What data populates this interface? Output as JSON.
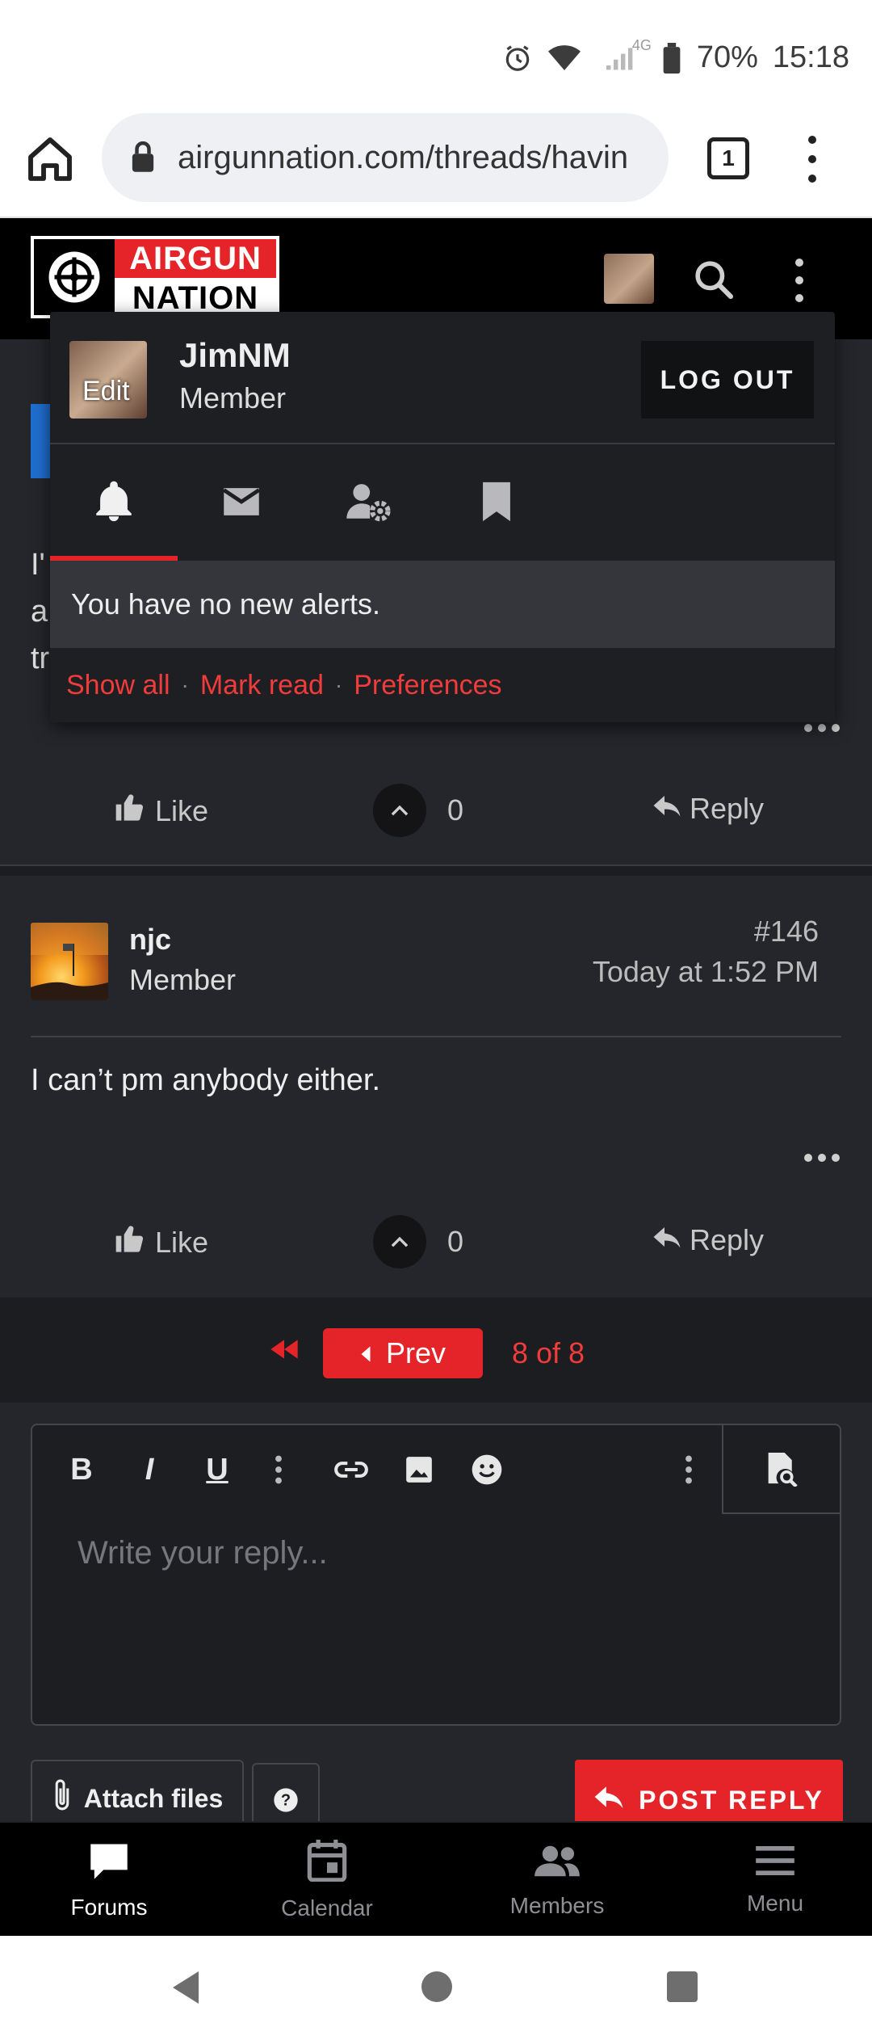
{
  "status_bar": {
    "network": "4G",
    "battery": "70%",
    "time": "15:18",
    "icons": [
      "alarm-icon",
      "wifi-icon",
      "signal-icon",
      "battery-icon"
    ]
  },
  "browser": {
    "url": "airgunnation.com/threads/havin",
    "tab_count": "1"
  },
  "site_header": {
    "logo_line1": "AIRGUN",
    "logo_line2": "NATION"
  },
  "background_post": {
    "letters": [
      "I'",
      "a",
      "tr"
    ]
  },
  "account_popup": {
    "avatar_edit": "Edit",
    "username": "JimNM",
    "role": "Member",
    "logout_label": "LOG OUT",
    "tabs": [
      "bell-icon",
      "envelope-icon",
      "user-cog-icon",
      "bookmark-icon"
    ],
    "active_tab": "bell-icon",
    "alerts_message": "You have no new alerts.",
    "links": {
      "show_all": "Show all",
      "mark_read": "Mark read",
      "preferences": "Preferences",
      "separator": "·"
    }
  },
  "post_actions_1": {
    "like": "Like",
    "vote_count": "0",
    "reply": "Reply"
  },
  "post": {
    "username": "njc",
    "role": "Member",
    "number": "#146",
    "time": "Today at 1:52 PM",
    "body": "I can’t pm anybody either.",
    "like": "Like",
    "vote_count": "0",
    "reply": "Reply"
  },
  "pagination": {
    "prev_label": "Prev",
    "status": "8 of 8"
  },
  "editor": {
    "placeholder": "Write your reply...",
    "toolbar": [
      "bold",
      "italic",
      "underline",
      "more",
      "link",
      "image",
      "emoji",
      "more",
      "preview"
    ]
  },
  "reply_actions": {
    "attach_label": "Attach files",
    "post_reply_label": "POST REPLY"
  },
  "bottom_nav": {
    "items": [
      "Forums",
      "Calendar",
      "Members",
      "Menu"
    ],
    "active": "Forums"
  },
  "colors": {
    "accent_red": "#e42428",
    "link_red": "#f23b3b",
    "background": "#25262b",
    "header_black": "#000000"
  }
}
